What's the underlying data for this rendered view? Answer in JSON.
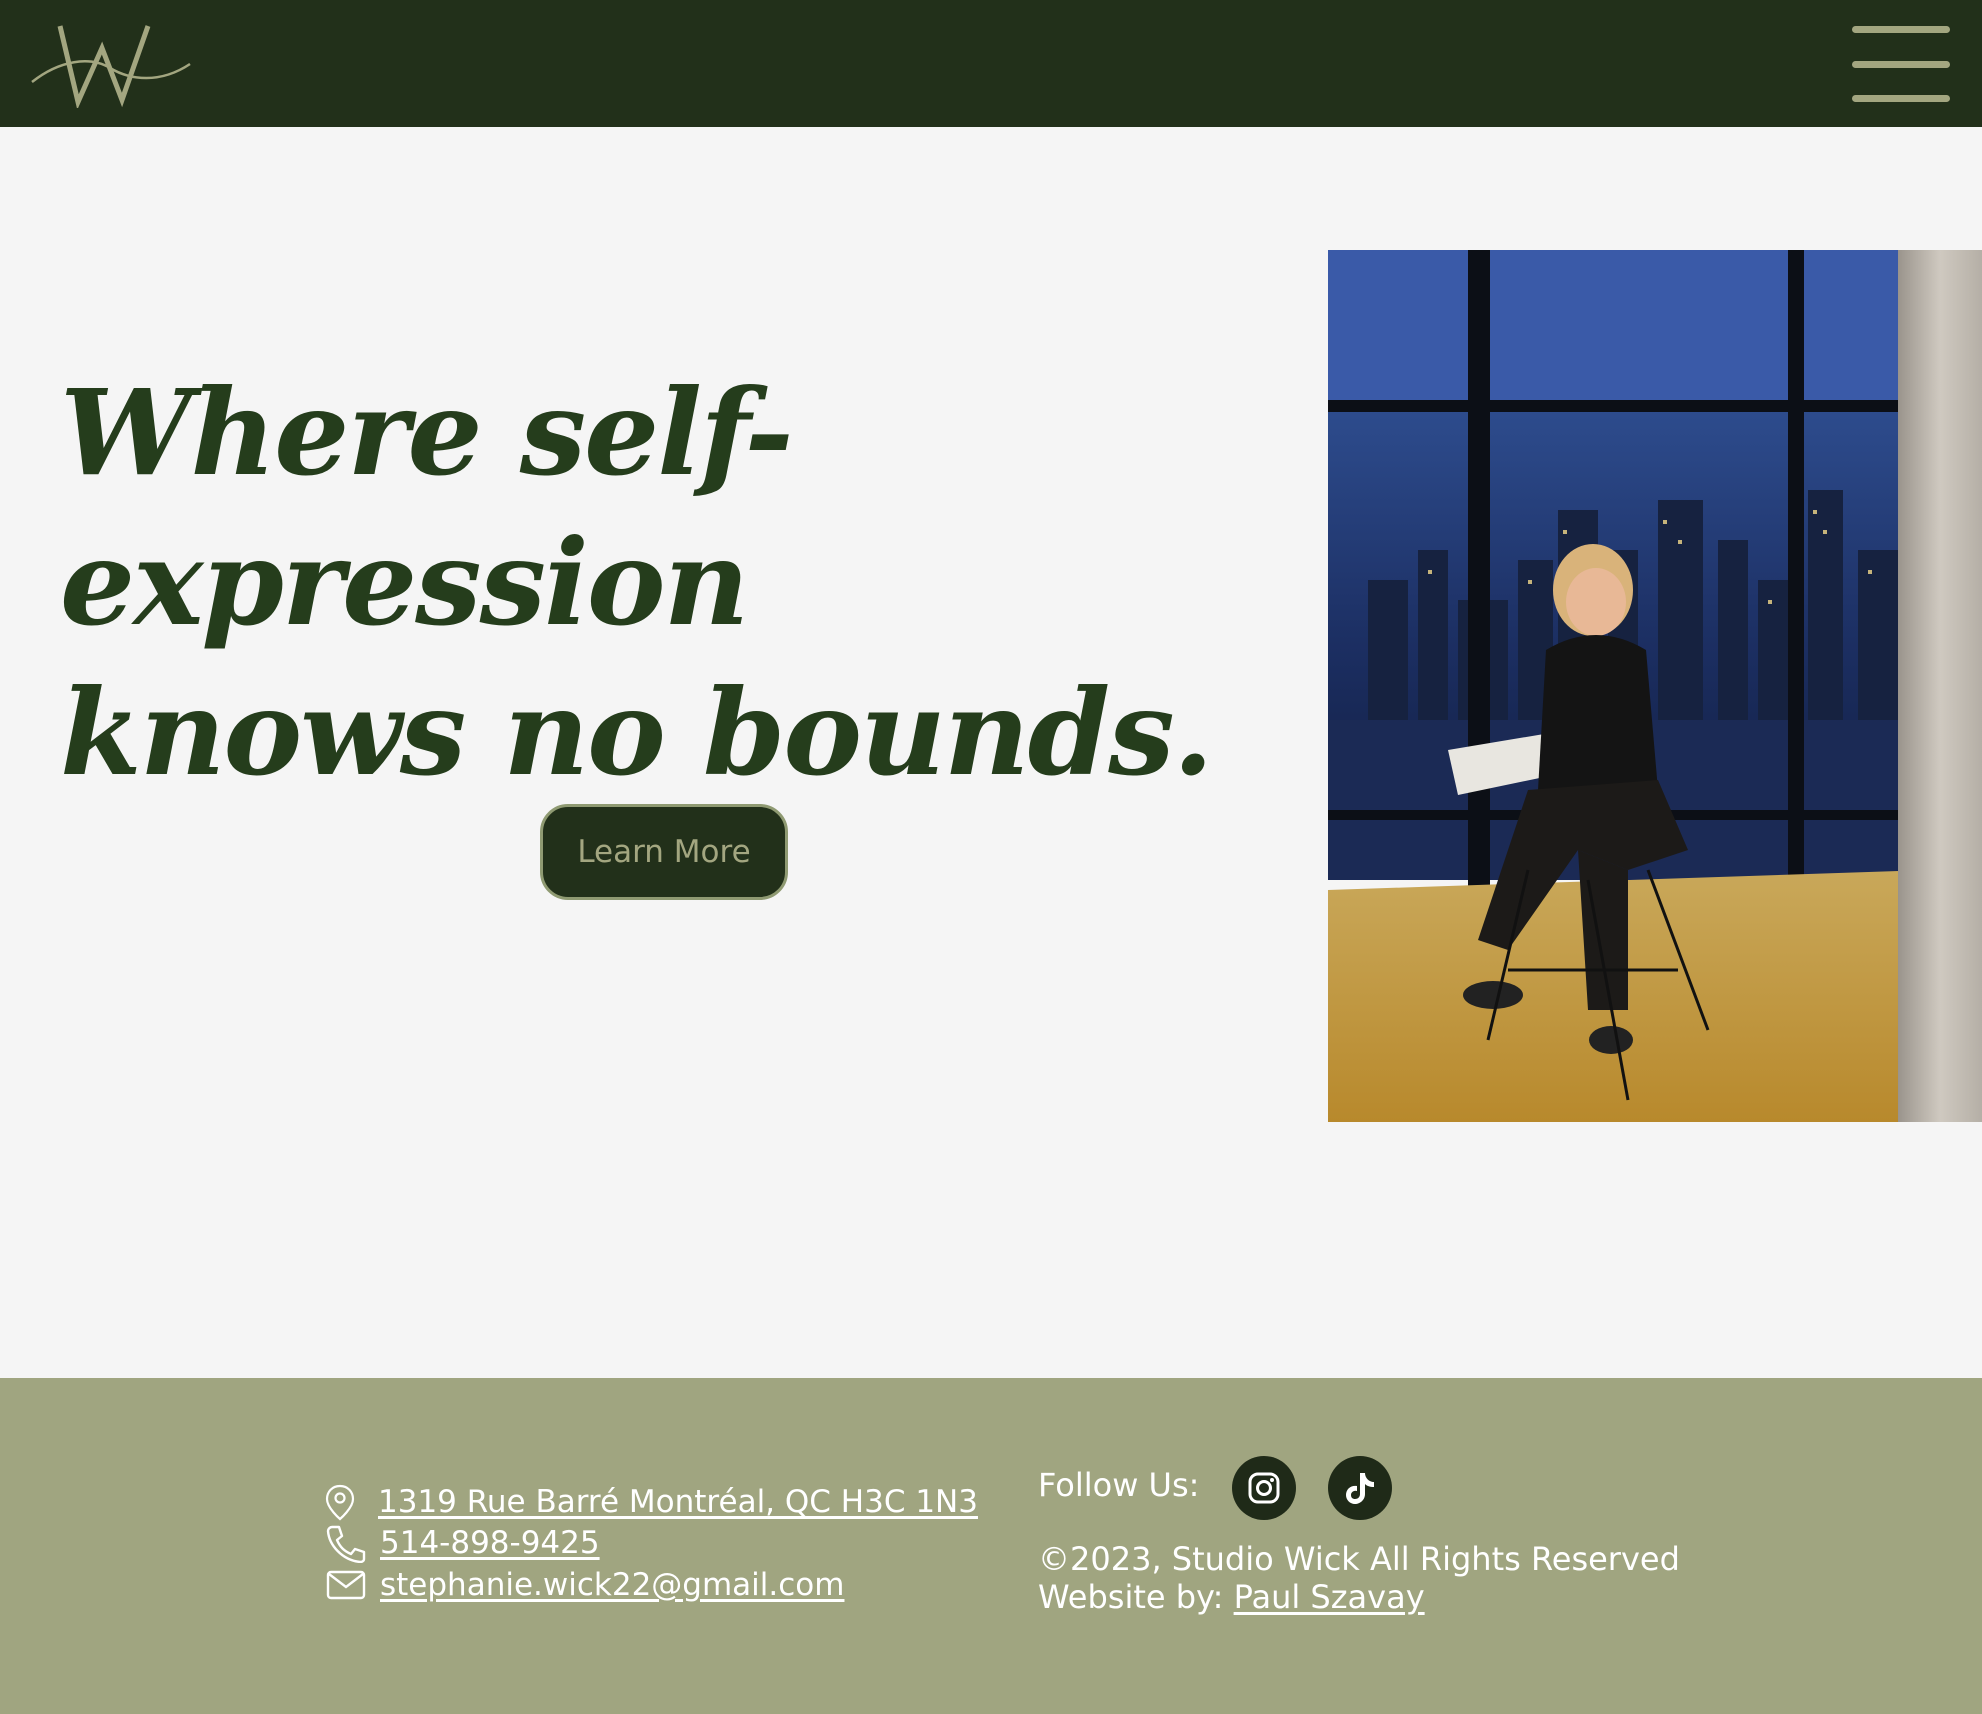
{
  "header": {
    "logo_icon": "wick-w-signature-logo",
    "menu_icon": "hamburger-menu-icon"
  },
  "hero": {
    "headline_line1": "Where self-expression",
    "headline_line2": "knows no bounds.",
    "cta_label": "Learn More",
    "photo_alt": "Woman seated on a bar stool in front of city skyline windows at night"
  },
  "footer": {
    "address": "1319 Rue Barré Montréal, QC H3C 1N3",
    "phone": "514-898-9425",
    "email": "stephanie.wick22@gmail.com",
    "follow_label": "Follow Us:",
    "social": [
      {
        "name": "instagram",
        "icon": "instagram-icon"
      },
      {
        "name": "tiktok",
        "icon": "tiktok-icon"
      }
    ],
    "copyright": "©2023, Studio Wick All Rights Reserved",
    "credit_prefix": "Website by: ",
    "credit_name": "Paul Szavay"
  },
  "colors": {
    "header_bg": "#22301a",
    "accent_olive": "#a3a680",
    "headline_green": "#253d1c",
    "page_bg": "#f5f5f5",
    "footer_bg": "#a0a580"
  }
}
